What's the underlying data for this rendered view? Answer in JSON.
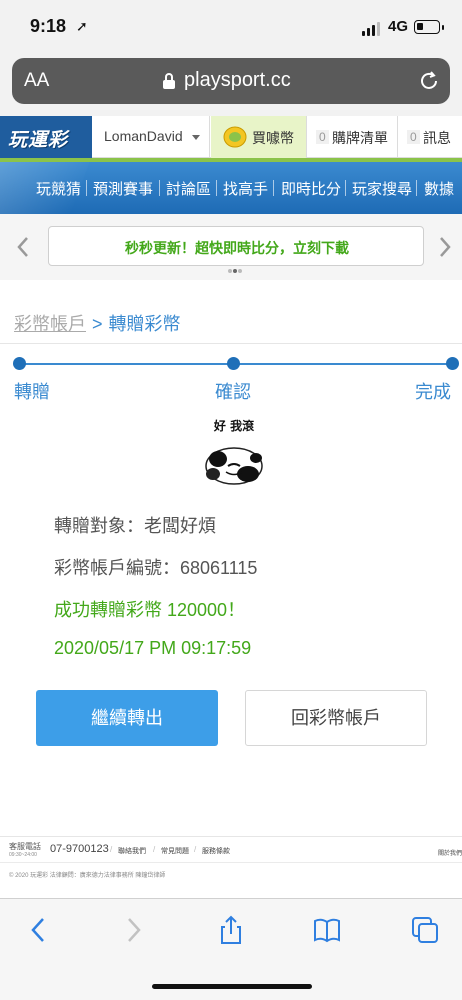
{
  "status_bar": {
    "time": "9:18",
    "network": "4G"
  },
  "browser": {
    "aa_label": "AA",
    "url": "playsport.cc"
  },
  "header": {
    "logo": "玩運彩",
    "username": "LomanDavid",
    "buy_coin": "買噱幣",
    "cart_count": "0",
    "cart_label": "購牌清單",
    "msg_count": "0",
    "msg_label": "訊息"
  },
  "nav": {
    "items": [
      "玩競猜",
      "預測賽事",
      "討論區",
      "找高手",
      "即時比分",
      "玩家搜尋",
      "數據"
    ]
  },
  "banner": {
    "text": "秒秒更新！超快即時比分，立刻下載"
  },
  "breadcrumb": {
    "parent": "彩幣帳戶",
    "separator": ">",
    "current": "轉贈彩幣"
  },
  "steps": [
    {
      "label": "轉贈"
    },
    {
      "label": "確認"
    },
    {
      "label": "完成"
    }
  ],
  "sticker": {
    "caption": "好 我滾"
  },
  "result": {
    "recipient": "轉贈對象：老闆好煩",
    "account_no": "彩幣帳戶編號：68061115",
    "success": "成功轉贈彩幣 120000！",
    "timestamp": "2020/05/17 PM 09:17:59"
  },
  "buttons": {
    "continue": "繼續轉出",
    "back": "回彩幣帳戶"
  },
  "footer": {
    "service_label": "客服電話",
    "hours": "09:30~24:00",
    "phone": "07-9700123",
    "links": [
      "聯絡我們",
      "常見問題",
      "服務條款"
    ],
    "right_link": "關於我們",
    "copyright": "© 2020 玩運彩 法律顧問：廣來德力法律事務所 陳鐘岱律師"
  },
  "colors": {
    "accent_blue": "#3a8ad0",
    "success_green": "#43a81a",
    "button_blue": "#3d9ee8"
  }
}
